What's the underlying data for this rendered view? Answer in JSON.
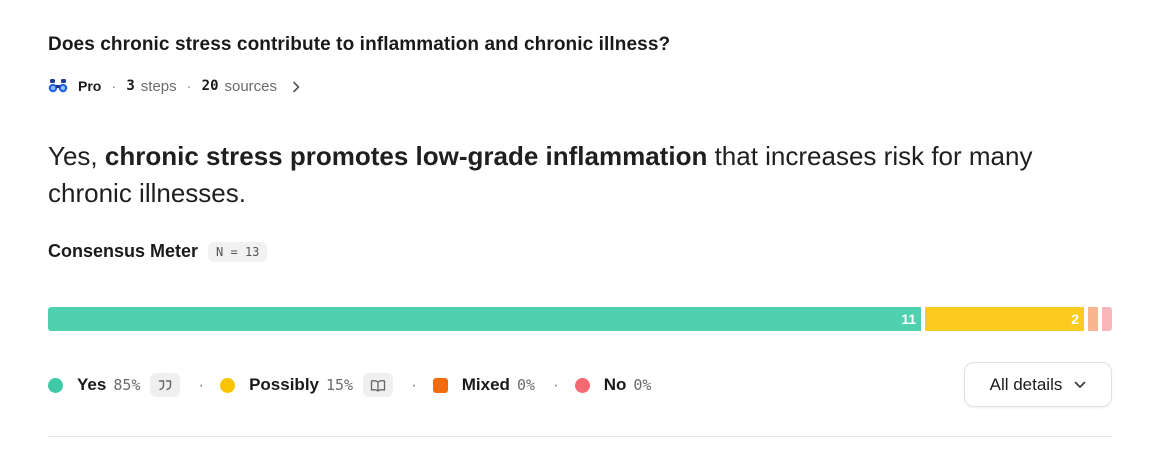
{
  "question": "Does chronic stress contribute to inflammation and chronic illness?",
  "meta": {
    "mode": "Pro",
    "steps_count": "3",
    "steps_label": "steps",
    "sources_count": "20",
    "sources_label": "sources"
  },
  "answer": {
    "prefix": "Yes, ",
    "bold": "chronic stress promotes low-grade inflammation",
    "suffix": " that increases risk for many chronic illnesses."
  },
  "meter": {
    "title": "Consensus Meter",
    "n_label": "N = 13",
    "segments": [
      {
        "name": "Yes",
        "count": 11,
        "label": "11",
        "color": "#4fd1b0"
      },
      {
        "name": "Possibly",
        "count": 2,
        "label": "2",
        "color": "#fccb1f"
      },
      {
        "name": "Mixed",
        "count": 0,
        "label": "",
        "color": "#f8b58f"
      },
      {
        "name": "No",
        "count": 0,
        "label": "",
        "color": "#f9b7b9"
      }
    ]
  },
  "legend": {
    "yes": {
      "name": "Yes",
      "pct": "85%",
      "color": "#3fc9a6",
      "icon": "quote-icon"
    },
    "possibly": {
      "name": "Possibly",
      "pct": "15%",
      "color": "#f8c400",
      "icon": "book-icon"
    },
    "mixed": {
      "name": "Mixed",
      "pct": "0%",
      "color": "#f26b0f"
    },
    "no": {
      "name": "No",
      "pct": "0%",
      "color": "#f46a74"
    },
    "separator": "·"
  },
  "details_button": {
    "label": "All details",
    "icon": "chevron-down-icon"
  }
}
